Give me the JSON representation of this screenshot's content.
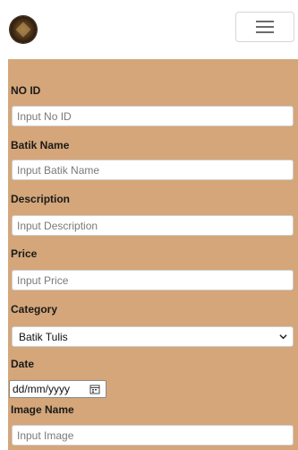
{
  "navbar": {
    "logo_icon": "batik-logo-icon",
    "toggler_icon": "hamburger-menu-icon"
  },
  "form": {
    "no_id": {
      "label": "NO ID",
      "placeholder": "Input No ID"
    },
    "batik_name": {
      "label": "Batik Name",
      "placeholder": "Input Batik Name"
    },
    "description": {
      "label": "Description",
      "placeholder": "Input Description"
    },
    "price": {
      "label": "Price",
      "placeholder": "Input Price"
    },
    "category": {
      "label": "Category",
      "selected": "Batik Tulis"
    },
    "date": {
      "label": "Date",
      "value": "dd/mm/yyyy"
    },
    "image_name": {
      "label": "Image Name",
      "placeholder": "Input Image"
    }
  },
  "colors": {
    "form_background": "#d4a67a",
    "page_background": "#ffffff"
  }
}
